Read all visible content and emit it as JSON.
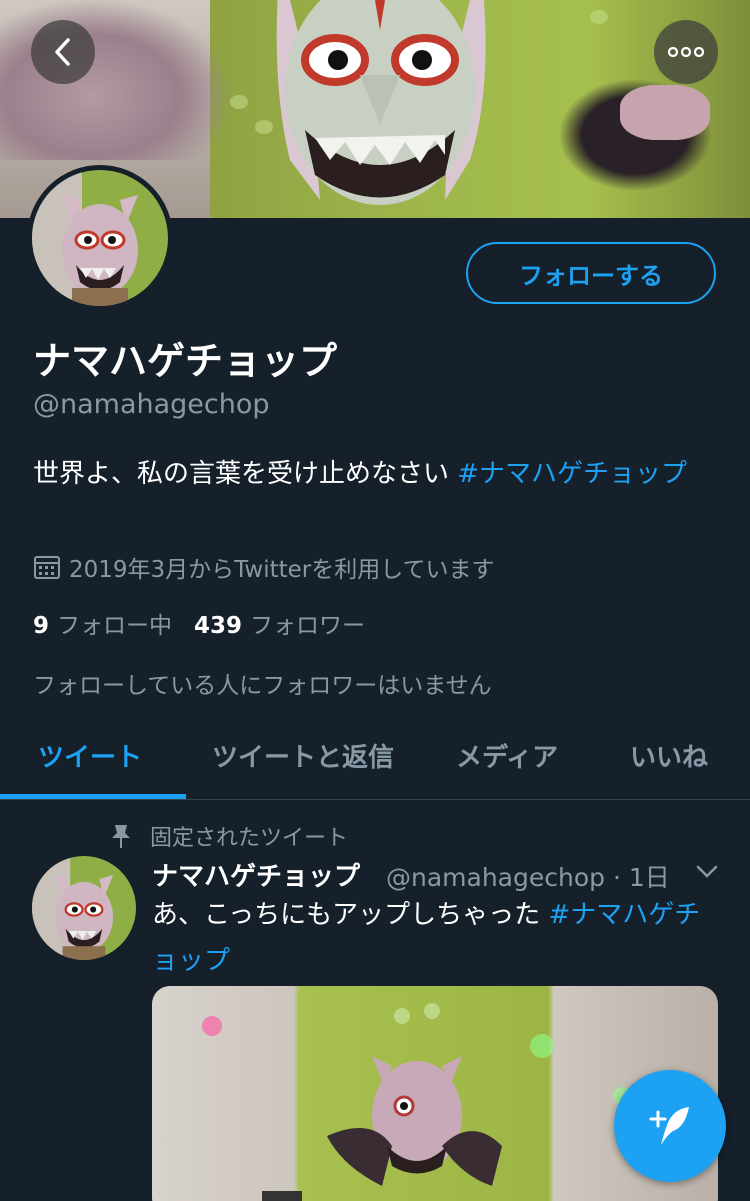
{
  "header": {
    "back_icon": "chevron-left-icon",
    "more_icon": "more-horizontal-icon"
  },
  "profile": {
    "follow_label": "フォローする",
    "display_name": "ナマハゲチョップ",
    "handle": "@namahagechop",
    "bio_text": "世界よ、私の言葉を受け止めなさい ",
    "bio_hashtag": "#ナマハゲチョップ",
    "joined": "2019年3月からTwitterを利用しています",
    "following_count": "9",
    "following_label": "フォロー中",
    "followers_count": "439",
    "followers_label": "フォロワー",
    "mutual_note": "フォローしている人にフォロワーはいません"
  },
  "tabs": [
    {
      "label": "ツイート",
      "active": true
    },
    {
      "label": "ツイートと返信",
      "active": false
    },
    {
      "label": "メディア",
      "active": false
    },
    {
      "label": "いいね",
      "active": false
    }
  ],
  "tweet": {
    "pinned_label": "固定されたツイート",
    "name": "ナマハゲチョップ",
    "handle_time": "@namahagechop · 1日",
    "text": "あ、こっちにもアップしちゃった ",
    "hashtag": "#ナマハゲチョップ"
  },
  "colors": {
    "background": "#15202b",
    "accent": "#1da1f2",
    "secondary_text": "#8899a6",
    "divider": "#38444d"
  },
  "fab_icon": "compose-tweet-icon"
}
